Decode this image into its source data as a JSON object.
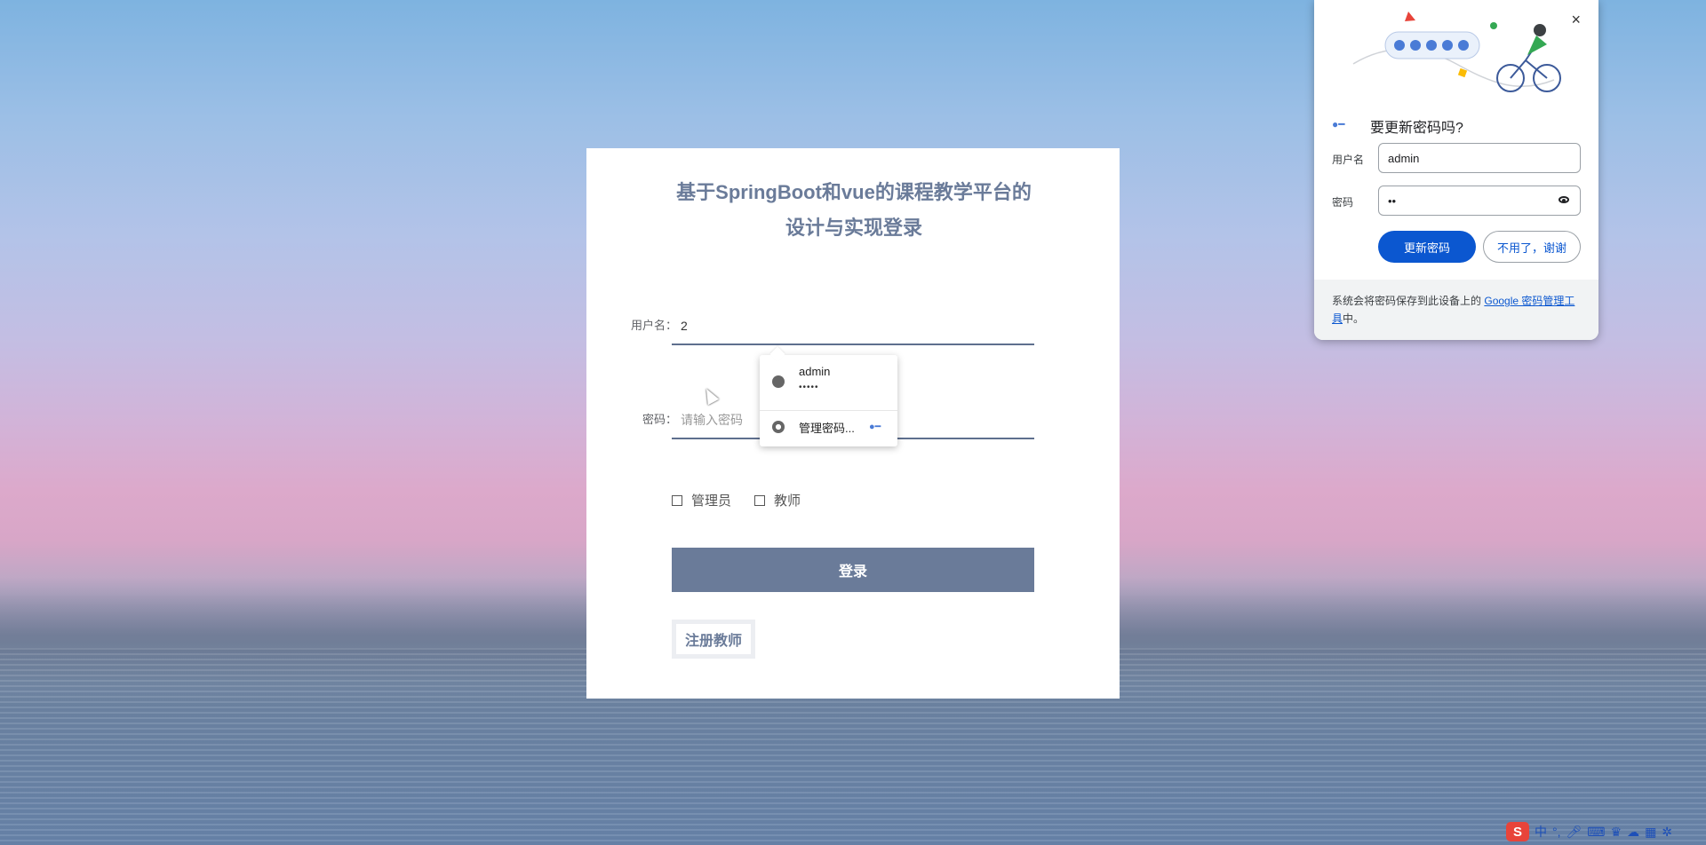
{
  "login": {
    "title": "基于SpringBoot和vue的课程教学平台的设计与实现登录",
    "username_label": "用户名：",
    "username_value": "2",
    "password_label": "密码：",
    "password_placeholder": "请输入密码",
    "checkbox_admin": "管理员",
    "checkbox_teacher": "教师",
    "login_button": "登录",
    "register_button": "注册教师"
  },
  "autofill": {
    "username": "admin",
    "password_mask": "•••••",
    "manage_label": "管理密码..."
  },
  "password_bubble": {
    "title": "要更新密码吗?",
    "username_label": "用户名",
    "username_value": "admin",
    "password_label": "密码",
    "password_value": "••",
    "update_button": "更新密码",
    "decline_button": "不用了，谢谢",
    "footer_text": "系统会将密码保存到此设备上的",
    "footer_link": "Google 密码管理工具",
    "footer_suffix": "中。",
    "close_icon": "×"
  },
  "ime": {
    "logo": "S",
    "mode": "中",
    "punct": "°,",
    "icons": [
      "mic-icon",
      "keyboard-icon",
      "skin-icon",
      "cloud-icon",
      "grid-icon",
      "settings-icon"
    ]
  }
}
